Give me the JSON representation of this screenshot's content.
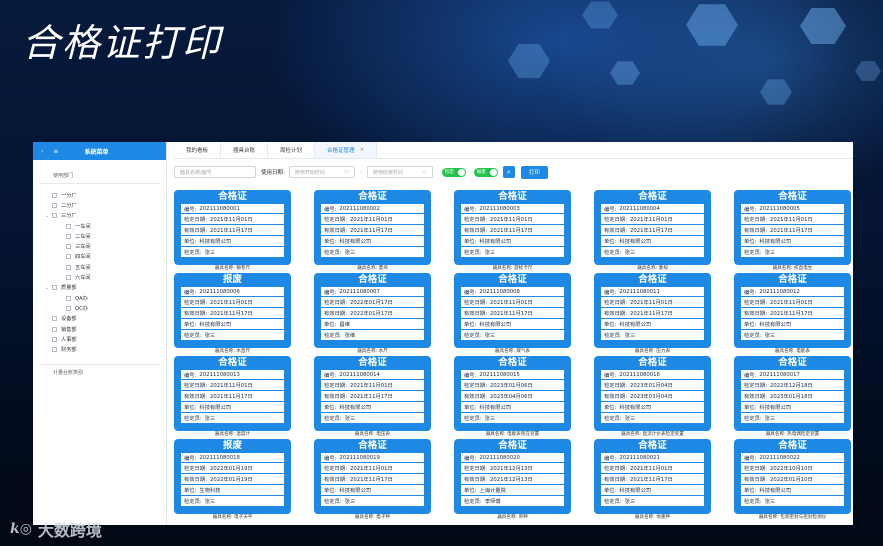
{
  "page_title": "合格证打印",
  "watermark": {
    "logo": "k◎",
    "text": "大数跨境"
  },
  "sidebar": {
    "menu_title": "系统菜单",
    "dept_label": "使用部门",
    "foot_label": "计量台账类别",
    "tree": [
      {
        "label": "一分厂",
        "depth": 0,
        "toggle": ""
      },
      {
        "label": "二分厂",
        "depth": 0,
        "toggle": ""
      },
      {
        "label": "三分厂",
        "depth": 0,
        "toggle": "⌄"
      },
      {
        "label": "一车间",
        "depth": 1,
        "toggle": ""
      },
      {
        "label": "二车间",
        "depth": 1,
        "toggle": ""
      },
      {
        "label": "三车间",
        "depth": 1,
        "toggle": ""
      },
      {
        "label": "四车间",
        "depth": 1,
        "toggle": ""
      },
      {
        "label": "五车间",
        "depth": 1,
        "toggle": ""
      },
      {
        "label": "六车间",
        "depth": 1,
        "toggle": ""
      },
      {
        "label": "质量部",
        "depth": 0,
        "toggle": "⌄"
      },
      {
        "label": "QA办",
        "depth": 1,
        "toggle": ""
      },
      {
        "label": "QC办",
        "depth": 1,
        "toggle": ""
      },
      {
        "label": "设备部",
        "depth": 0,
        "toggle": ""
      },
      {
        "label": "销售部",
        "depth": 0,
        "toggle": ""
      },
      {
        "label": "人事部",
        "depth": 0,
        "toggle": ""
      },
      {
        "label": "财务部",
        "depth": 0,
        "toggle": ""
      }
    ]
  },
  "tabs": [
    {
      "label": "我的看板",
      "active": false
    },
    {
      "label": "器具台账",
      "active": false
    },
    {
      "label": "周检计划",
      "active": false
    },
    {
      "label": "合格证管理",
      "active": true
    }
  ],
  "toolbar": {
    "name_placeholder": "器具名称/编号",
    "date_label": "使用日期:",
    "start_placeholder": "使用开始时间",
    "range_sep": "-",
    "end_placeholder": "使用结束时间",
    "toggle1": "检定",
    "toggle2": "报废",
    "print_label": "打印"
  },
  "field_labels": {
    "no": "编号:",
    "check": "检定日期:",
    "valid": "有效日期:",
    "unit": "单位:",
    "inspector": "检定员:"
  },
  "caption_prefix": "器具名称:",
  "cards": [
    {
      "title": "合格证",
      "no": "202111080001",
      "check": "2021年11月01日",
      "valid": "2021年11月17日",
      "unit": "科技有限公司",
      "inspector": "张三",
      "name": "钢卷尺"
    },
    {
      "title": "合格证",
      "no": "202111080002",
      "check": "2021年11月01日",
      "valid": "2021年11月17日",
      "unit": "科技有限公司",
      "inspector": "张三",
      "name": "量块"
    },
    {
      "title": "合格证",
      "no": "202111080003",
      "check": "2021年11月01日",
      "valid": "2021年11月17日",
      "unit": "科技有限公司",
      "inspector": "张三",
      "name": "游标卡尺"
    },
    {
      "title": "合格证",
      "no": "202111080004",
      "check": "2021年11月01日",
      "valid": "2021年11月17日",
      "unit": "科技有限公司",
      "inspector": "张三",
      "name": "塞规"
    },
    {
      "title": "合格证",
      "no": "202111080005",
      "check": "2021年11月01日",
      "valid": "2021年11月17日",
      "unit": "科技有限公司",
      "inspector": "张三",
      "name": "校直电生"
    },
    {
      "title": "报废",
      "no": "202111080006",
      "check": "2021年11月01日",
      "valid": "2021年11月17日",
      "unit": "科技有限公司",
      "inspector": "张三",
      "name": "木直尺"
    },
    {
      "title": "合格证",
      "no": "202111080007",
      "check": "2022年01月17日",
      "valid": "2022年01月17日",
      "unit": "昌维",
      "inspector": "张维",
      "name": "水尺"
    },
    {
      "title": "合格证",
      "no": "202111080008",
      "check": "2021年11月01日",
      "valid": "2021年11月17日",
      "unit": "科技有限公司",
      "inspector": "张三",
      "name": "煤气表"
    },
    {
      "title": "合格证",
      "no": "202111080011",
      "check": "2021年11月01日",
      "valid": "2021年11月17日",
      "unit": "科技有限公司",
      "inspector": "张三",
      "name": "压力表"
    },
    {
      "title": "合格证",
      "no": "202111080012",
      "check": "2021年11月01日",
      "valid": "2021年11月17日",
      "unit": "科技有限公司",
      "inspector": "张三",
      "name": "电能表"
    },
    {
      "title": "合格证",
      "no": "202111080013",
      "check": "2021年11月01日",
      "valid": "2021年11月17日",
      "unit": "科技有限公司",
      "inspector": "张三",
      "name": "温度计"
    },
    {
      "title": "合格证",
      "no": "202111080014",
      "check": "2021年11月01日",
      "valid": "2021年11月17日",
      "unit": "科技有限公司",
      "inspector": "张三",
      "name": "电压表"
    },
    {
      "title": "合格证",
      "no": "202111080015",
      "check": "2023年01月06日",
      "valid": "2023年04月06日",
      "unit": "科技有限公司",
      "inspector": "张三",
      "name": "电能表现在装置"
    },
    {
      "title": "合格证",
      "no": "202111080016",
      "check": "2023年01月04日",
      "valid": "2023年03月04日",
      "unit": "科技有限公司",
      "inspector": "张三",
      "name": "直流计价表检定装置"
    },
    {
      "title": "合格证",
      "no": "202111080017",
      "check": "2022年12月18日",
      "valid": "2023年01月18日",
      "unit": "科技有限公司",
      "inspector": "张三",
      "name": "热电偶检定装置"
    },
    {
      "title": "报废",
      "no": "202111080018",
      "check": "2022年01月19日",
      "valid": "2022年01月19日",
      "unit": "生物科技",
      "inspector": "张三",
      "name": "电子天平"
    },
    {
      "title": "合格证",
      "no": "202111080019",
      "check": "2021年11月01日",
      "valid": "2021年11月17日",
      "unit": "科技有限公司",
      "inspector": "张三",
      "name": "电子秤"
    },
    {
      "title": "合格证",
      "no": "202111080020",
      "check": "2021年12月13日",
      "valid": "2021年12月13日",
      "unit": "上海计量院",
      "inspector": "李师傅",
      "name": "吊秤"
    },
    {
      "title": "合格证",
      "no": "202111080021",
      "check": "2021年11月01日",
      "valid": "2021年11月17日",
      "unit": "科技有限公司",
      "inspector": "张三",
      "name": "地重秤"
    },
    {
      "title": "合格证",
      "no": "202111080022",
      "check": "2022年10月10日",
      "valid": "2022年01月10日",
      "unit": "科技有限公司",
      "inspector": "张三",
      "name": "包装密封与密封检测仪"
    }
  ]
}
